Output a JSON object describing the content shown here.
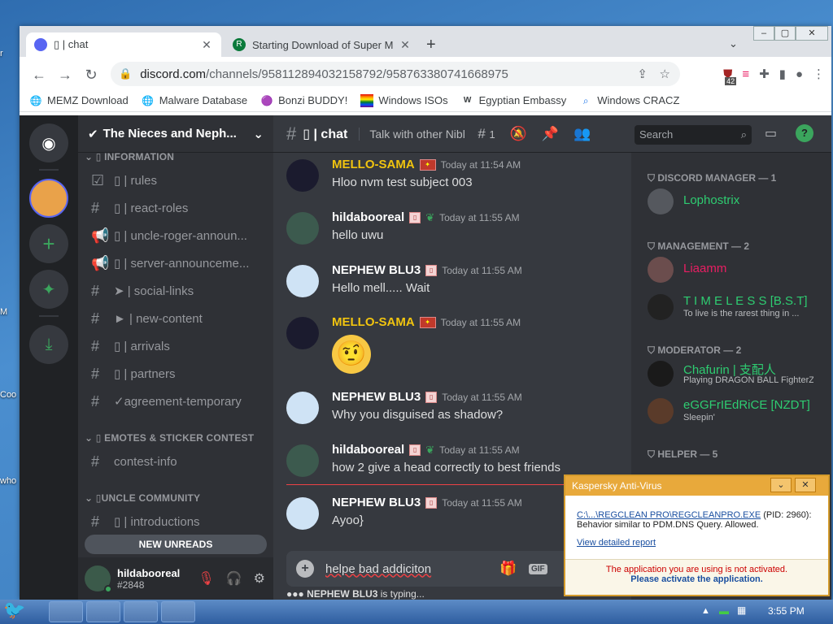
{
  "browser": {
    "tabs": [
      {
        "label": "▯ | chat",
        "icon": "discord-tab-icon"
      },
      {
        "label": "Starting Download of Super M",
        "icon": "r-tab-icon"
      }
    ],
    "url_host": "discord.com",
    "url_path": "/channels/958112894032158792/958763380741668975",
    "extension_badge": "42",
    "bookmarks": [
      {
        "label": "MEMZ Download",
        "icon": "globe-icon"
      },
      {
        "label": "Malware Database",
        "icon": "globe-icon"
      },
      {
        "label": "Bonzi BUDDY!",
        "icon": "bonzi-icon"
      },
      {
        "label": "Windows ISOs",
        "icon": "rainbow-flag-icon"
      },
      {
        "label": "Egyptian Embassy",
        "icon": "wix-icon"
      },
      {
        "label": "Windows CRACZ",
        "icon": "search-icon"
      }
    ]
  },
  "server": {
    "name": "The Nieces and Neph...",
    "categories": [
      {
        "label": "▯ INFORMATION"
      },
      {
        "label": "▯ EMOTES & STICKER CONTEST"
      },
      {
        "label": "▯UNCLE COMMUNITY"
      }
    ],
    "channels": [
      {
        "prefix": "☑",
        "label": "▯ | rules"
      },
      {
        "prefix": "#",
        "label": "▯ | react-roles"
      },
      {
        "prefix": "📢",
        "label": "▯ | uncle-roger-announ..."
      },
      {
        "prefix": "📢",
        "label": "▯ | server-announceme..."
      },
      {
        "prefix": "#",
        "label": "➤ | social-links"
      },
      {
        "prefix": "#",
        "label": "► | new-content"
      },
      {
        "prefix": "#",
        "label": "▯ | arrivals"
      },
      {
        "prefix": "#",
        "label": "▯ | partners"
      },
      {
        "prefix": "#",
        "label": "✓agreement-temporary"
      },
      {
        "prefix": "#",
        "label": "contest-info"
      },
      {
        "prefix": "#",
        "label": "▯ | introductions"
      }
    ],
    "new_unreads": "NEW UNREADS"
  },
  "user": {
    "name": "hildabooreal",
    "tag": "#2848"
  },
  "chat": {
    "channel_name": "▯ | chat",
    "topic": "Talk with other Nibl...",
    "thread_count": "1",
    "search_placeholder": "Search",
    "messages": [
      {
        "author": "MELLO-SAMA",
        "color": "#f1c40f",
        "badge": "FUII YOH",
        "time": "Today at 11:54 AM",
        "text": "Hloo nvm test subject 003"
      },
      {
        "author": "hildabooreal",
        "color": "#ffffff",
        "badge": "▯",
        "time": "Today at 11:55 AM",
        "text": "hello uwu"
      },
      {
        "author": "NEPHEW BLU3",
        "color": "#ffffff",
        "badge": "▯",
        "time": "Today at 11:55 AM",
        "text": "Hello mell..... Wait"
      },
      {
        "author": "MELLO-SAMA",
        "color": "#f1c40f",
        "badge": "FUII YOH",
        "time": "Today at 11:55 AM",
        "text": "🤨"
      },
      {
        "author": "NEPHEW BLU3",
        "color": "#ffffff",
        "badge": "▯",
        "time": "Today at 11:55 AM",
        "text": "Why you disguised as shadow?"
      },
      {
        "author": "hildabooreal",
        "color": "#ffffff",
        "badge": "▯",
        "time": "Today at 11:55 AM",
        "text": "how 2 give a head correctly to best friends"
      },
      {
        "author": "NEPHEW BLU3",
        "color": "#ffffff",
        "badge": "▯",
        "time": "Today at 11:55 AM",
        "text": "Ayoo}"
      }
    ],
    "composer_text": "helpe bad addiciton",
    "typing": "NEPHEW BLU3",
    "typing_suffix": " is typing..."
  },
  "members": {
    "groups": [
      {
        "label": "DISCORD MANAGER — 1"
      },
      {
        "label": "MANAGEMENT — 2"
      },
      {
        "label": "MODERATOR — 2"
      },
      {
        "label": "HELPER — 5"
      }
    ],
    "list": [
      {
        "name": "Lophostrix",
        "color": "#2ecc71",
        "status": ""
      },
      {
        "name": "Liaamm",
        "color": "#e91e63",
        "status": ""
      },
      {
        "name": "T I M E L E S S [B.S.T]",
        "color": "#2ecc71",
        "status": "To live is the rarest thing in ..."
      },
      {
        "name": "Chafurin | 支配人",
        "color": "#2ecc71",
        "status": "Playing DRAGON BALL FighterZ"
      },
      {
        "name": "eGGFrIEdRiCE [NZDT]",
        "color": "#2ecc71",
        "status": "Sleepin'"
      }
    ]
  },
  "kaspersky": {
    "title": "Kaspersky Anti-Virus",
    "path": "C:\\...\\REGCLEAN PRO\\REGCLEANPRO.EXE",
    "pid": " (PID: 2960):",
    "behavior": "Behavior similar to PDM.DNS Query. Allowed.",
    "report_link": "View detailed report",
    "warning": "The application you are using is not activated.",
    "activate": "Please activate the application."
  },
  "taskbar": {
    "clock": "3:55 PM"
  }
}
